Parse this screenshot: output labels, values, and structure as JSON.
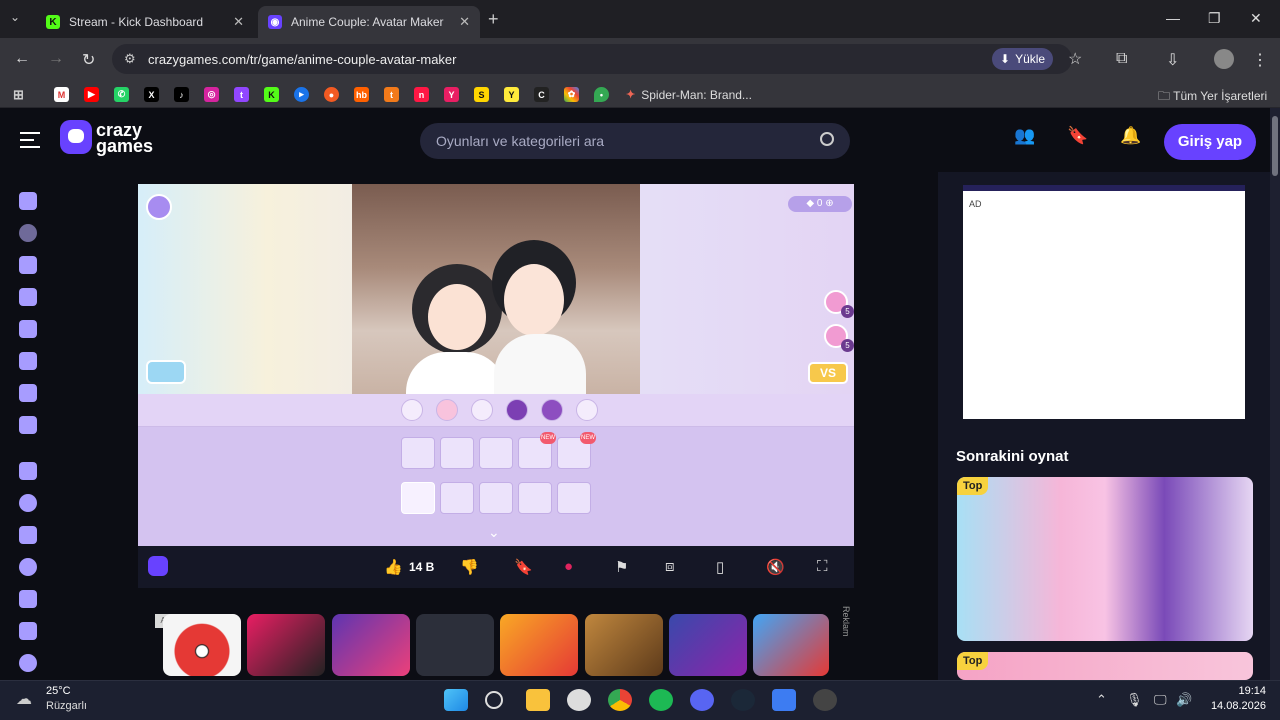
{
  "browser": {
    "tabs": [
      {
        "title": "Stream - Kick Dashboard",
        "active": false
      },
      {
        "title": "Anime Couple: Avatar Maker",
        "active": true
      }
    ],
    "url": "crazygames.com/tr/game/anime-couple-avatar-maker",
    "install_label": "Yükle",
    "bookmarks": {
      "spider": "Spider-Man: Brand...",
      "all": "Tüm Yer İşaretleri"
    }
  },
  "site": {
    "logo_line1": "crazy",
    "logo_line2": "games",
    "search_placeholder": "Oyunları ve kategorileri ara",
    "login_label": "Giriş yap",
    "accent": "#6842ff"
  },
  "game": {
    "gem_count": "0",
    "badges": [
      "5",
      "5"
    ],
    "vs_label": "VS",
    "new_label": "NEW"
  },
  "gamebar": {
    "like_count": "14 B"
  },
  "ads": {
    "label": "AD",
    "reklam": "Reklam",
    "right_label": "AD"
  },
  "rightcol": {
    "next_title": "Sonrakini oynat",
    "top_label": "Top"
  },
  "taskbar": {
    "temp": "25°C",
    "weather": "Rüzgarlı",
    "time": "19:14",
    "date": "14.08.2026"
  }
}
